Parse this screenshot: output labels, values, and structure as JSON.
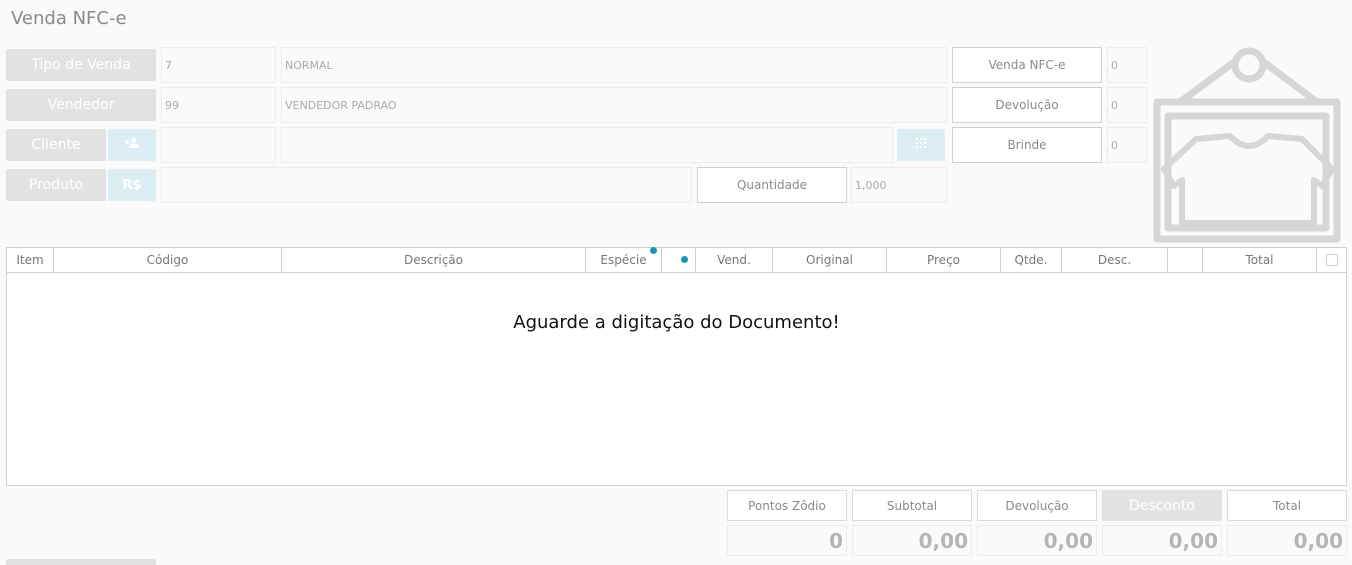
{
  "window": {
    "title": "Venda NFC-e"
  },
  "form": {
    "tipo_venda": {
      "label": "Tipo de Venda",
      "code": "7",
      "desc": "NORMAL"
    },
    "vendedor": {
      "label": "Vendedor",
      "code": "99",
      "desc": "VENDEDOR PADRAO"
    },
    "cliente": {
      "label": "Cliente",
      "code": "",
      "desc": "",
      "add_icon": "add-person-icon",
      "keypad_icon": "keypad-icon"
    },
    "produto": {
      "label": "Produto",
      "price_icon": "R$",
      "value": ""
    },
    "quantidade": {
      "label": "Quantidade",
      "value": "1,000"
    }
  },
  "counters": [
    {
      "label": "Venda NFC-e",
      "value": "0"
    },
    {
      "label": "Devolução",
      "value": "0"
    },
    {
      "label": "Brinde",
      "value": "0"
    }
  ],
  "product_image": {
    "icon": "tshirt-tag-icon"
  },
  "grid": {
    "columns": [
      "Item",
      "Código",
      "Descrição",
      "Espécie",
      "",
      "Vend.",
      "Original",
      "Preço",
      "Qtde.",
      "Desc.",
      "",
      "Total",
      ""
    ],
    "empty_message": "Aguarde a digitação do Documento!"
  },
  "totals": [
    {
      "label": "Pontos Zôdio",
      "value": "0"
    },
    {
      "label": "Subtotal",
      "value": "0,00"
    },
    {
      "label": "Devolução",
      "value": "0,00"
    },
    {
      "label": "Desconto",
      "value": "0,00"
    },
    {
      "label": "Total",
      "value": "0,00"
    }
  ],
  "colors": {
    "accent": "#1a93b5",
    "button_disabled": "#e2e2e2",
    "icon_button": "#dcedf4"
  }
}
